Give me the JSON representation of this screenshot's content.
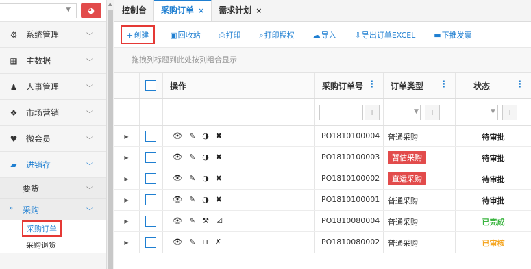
{
  "sidebar": {
    "top_button_icon": "dashboard-gauge-icon",
    "menu": [
      {
        "icon": "gears-icon",
        "label": "系统管理"
      },
      {
        "icon": "grid-icon",
        "label": "主数据"
      },
      {
        "icon": "user-icon",
        "label": "人事管理"
      },
      {
        "icon": "dropbox-icon",
        "label": "市场营销"
      },
      {
        "icon": "heart-icon",
        "label": "微会员"
      },
      {
        "icon": "briefcase-icon",
        "label": "进销存"
      }
    ],
    "sub": [
      {
        "label": "要货"
      },
      {
        "label": "采购"
      }
    ],
    "leaves": [
      {
        "label": "采购订单"
      },
      {
        "label": "采购退货"
      }
    ]
  },
  "tabs": [
    {
      "label": "控制台"
    },
    {
      "label": "采购订单",
      "close": "×"
    },
    {
      "label": "需求计划",
      "close": "×"
    }
  ],
  "toolbar": [
    {
      "label": "创建",
      "icon": "+"
    },
    {
      "label": "回收站",
      "icon": "▣"
    },
    {
      "label": "打印",
      "icon": "⎙"
    },
    {
      "label": "打印授权",
      "icon": "⌕"
    },
    {
      "label": "导入",
      "icon": "☁"
    },
    {
      "label": "导出订单EXCEL",
      "icon": "⇩"
    },
    {
      "label": "下推发票",
      "icon": "▬"
    }
  ],
  "group_hint": "拖拽列标题到此处按列组合显示",
  "columns": {
    "op": "操作",
    "po": "采购订单号",
    "type": "订单类型",
    "status": "状态"
  },
  "rows": [
    {
      "po": "PO1810100004",
      "type": "普通采购",
      "type_badge": false,
      "status": "待审批",
      "status_kind": "pending",
      "ops": [
        "👁",
        "✎",
        "◑",
        "✖"
      ]
    },
    {
      "po": "PO1810100003",
      "type": "暂估采购",
      "type_badge": true,
      "status": "待审批",
      "status_kind": "pending",
      "ops": [
        "👁",
        "✎",
        "◑",
        "✖"
      ]
    },
    {
      "po": "PO1810100002",
      "type": "直运采购",
      "type_badge": true,
      "status": "待审批",
      "status_kind": "pending",
      "ops": [
        "👁",
        "✎",
        "◑",
        "✖"
      ]
    },
    {
      "po": "PO1810100001",
      "type": "普通采购",
      "type_badge": false,
      "status": "待审批",
      "status_kind": "pending",
      "ops": [
        "👁",
        "✎",
        "◑",
        "✖"
      ]
    },
    {
      "po": "PO1810080004",
      "type": "普通采购",
      "type_badge": false,
      "status": "已完成",
      "status_kind": "done",
      "ops": [
        "👁",
        "✎",
        "⚒",
        "☑"
      ]
    },
    {
      "po": "PO1810080002",
      "type": "普通采购",
      "type_badge": false,
      "status": "已审核",
      "status_kind": "checked",
      "ops": [
        "👁",
        "✎",
        "⊔",
        "✗"
      ]
    }
  ],
  "colors": {
    "accent": "#1f7fd1",
    "danger": "#e24b4b",
    "done": "#3bb540",
    "checked": "#f5a623"
  }
}
